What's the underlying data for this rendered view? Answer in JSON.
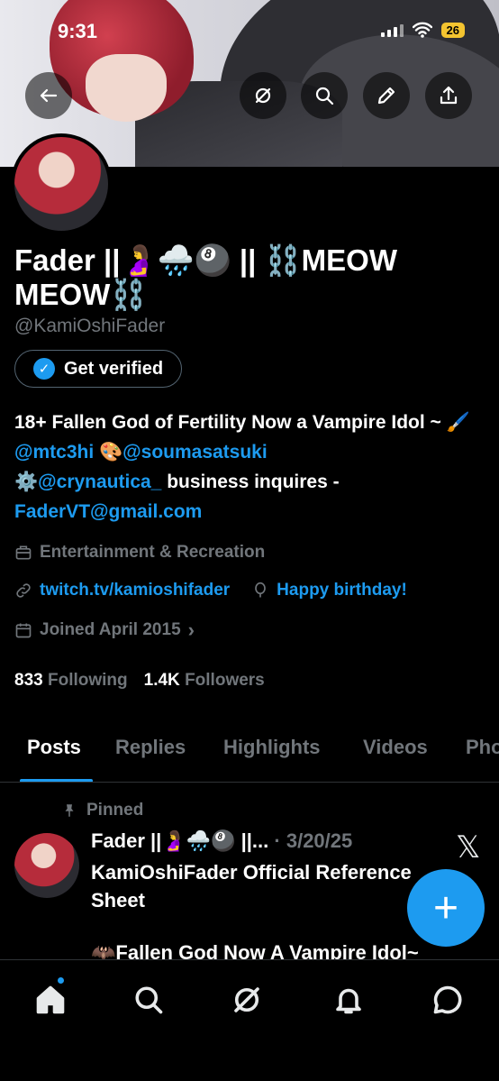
{
  "status_bar": {
    "time": "9:31",
    "battery": "26"
  },
  "profile": {
    "display_name_line1": "Fader ||🤰🌧️🎱 || ⛓️MEOW",
    "display_name_line2": "MEOW⛓️",
    "handle": "@KamiOshiFader",
    "verified_label": "Get verified",
    "bio": {
      "part1": "18+ Fallen God of Fertility Now a Vampire Idol ~ 🖌️",
      "mention1": "@mtc3hi",
      "part2": " 🎨",
      "mention2": "@soumasatsuki",
      "part3": "⚙️",
      "mention3": "@crynautica_",
      "part4": " business inquires - ",
      "email": "FaderVT@gmail.com"
    },
    "category": "Entertainment & Recreation",
    "website": "twitch.tv/kamioshifader",
    "birthday": "Happy birthday!",
    "joined": "Joined April 2015",
    "following_count": "833",
    "following_label": "Following",
    "followers_count": "1.4K",
    "followers_label": "Followers"
  },
  "tabs": [
    "Posts",
    "Replies",
    "Highlights",
    "Videos",
    "Pho"
  ],
  "post": {
    "pinned_label": "Pinned",
    "author": "Fader ||🤰🌧️🎱 ||...",
    "date": "· 3/20/25",
    "text": "KamiOshiFader Official Reference Sheet",
    "text2": "🦇Fallen God Now A Vampire Idol~"
  },
  "icons": {
    "back": "back-arrow-icon",
    "grok": "grok-icon",
    "search": "search-icon",
    "edit": "pencil-icon",
    "share": "share-icon",
    "x_logo": "x-logo-icon",
    "compose": "plus-icon"
  },
  "colors": {
    "accent": "#1d9bf0",
    "background": "#000000",
    "muted": "#71767b"
  }
}
